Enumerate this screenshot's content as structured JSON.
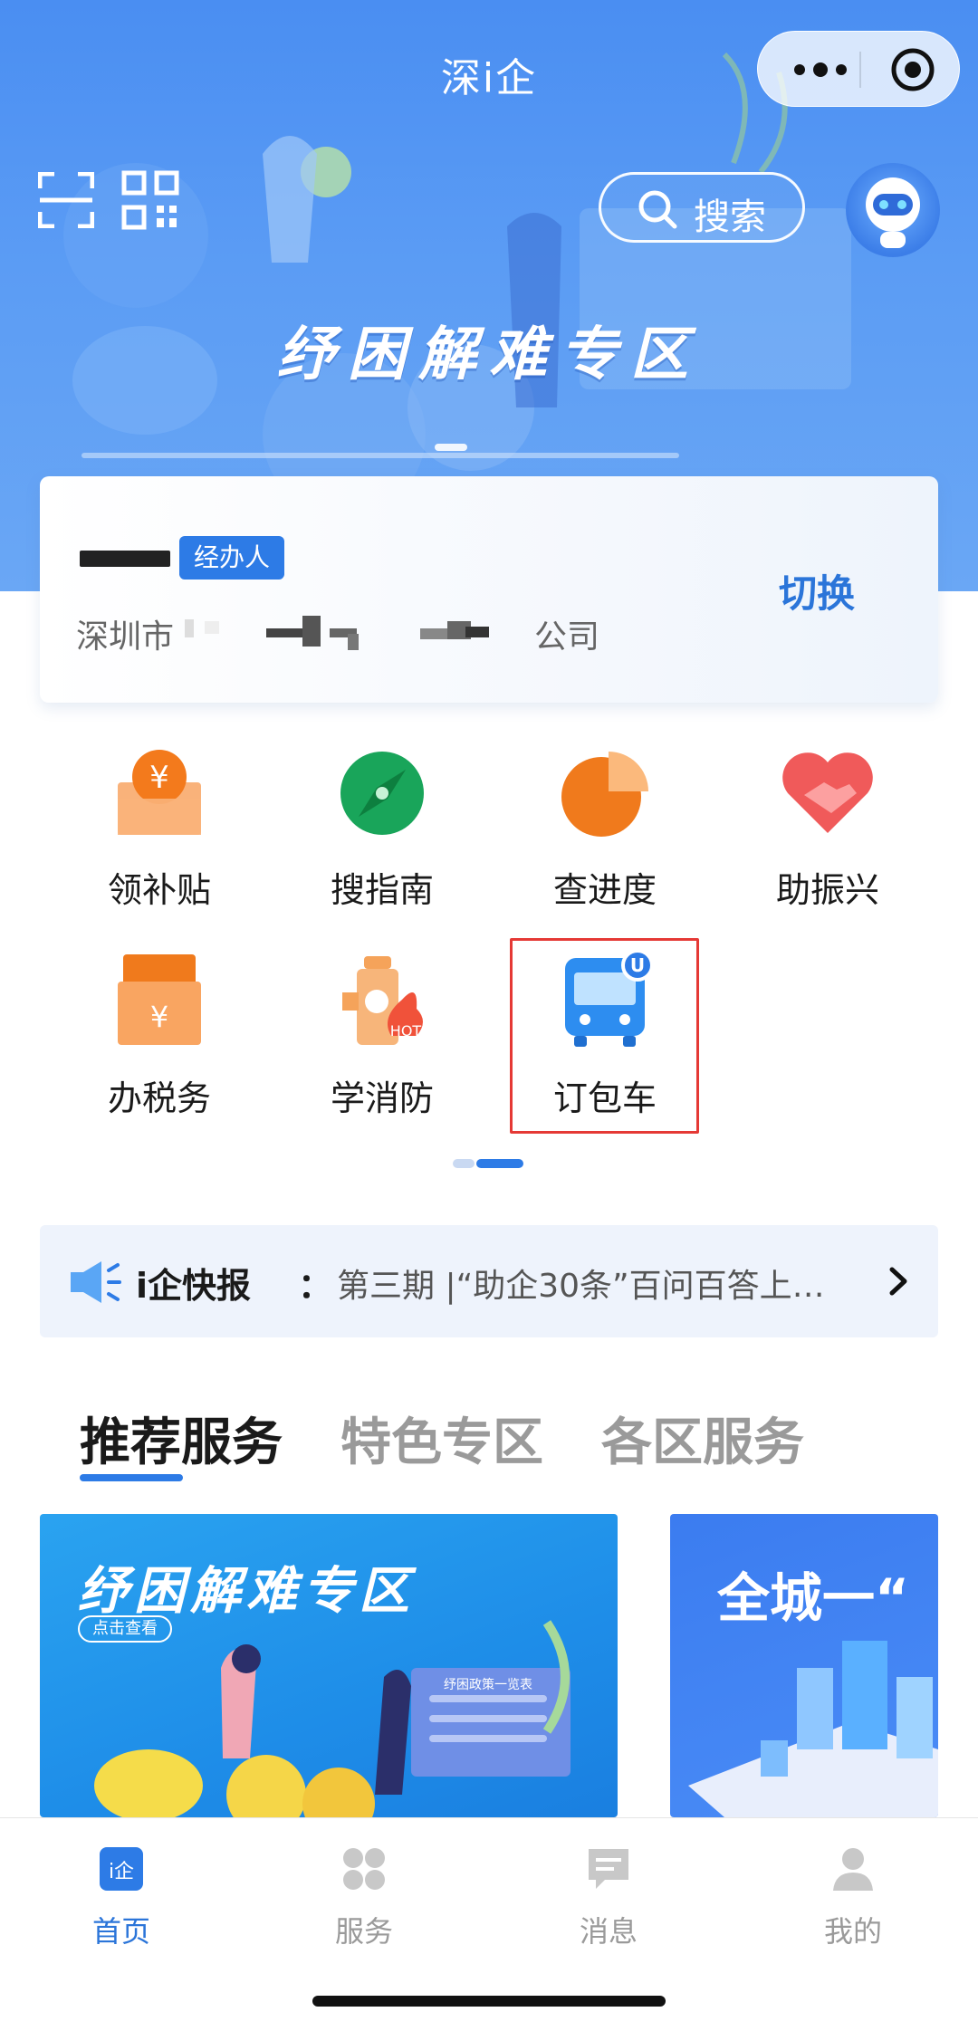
{
  "nav": {
    "title": "深i企"
  },
  "banner": {
    "search_label": "搜索",
    "slogan": "纾困解难专区"
  },
  "user": {
    "role": "经办人",
    "company_prefix": "深圳市",
    "company_suffix": "公司",
    "switch_label": "切换"
  },
  "quick_entries": [
    {
      "label": "领补贴",
      "icon": "subsidy-icon"
    },
    {
      "label": "搜指南",
      "icon": "compass-icon"
    },
    {
      "label": "查进度",
      "icon": "progress-pie-icon"
    },
    {
      "label": "助振兴",
      "icon": "handshake-heart-icon"
    },
    {
      "label": "办税务",
      "icon": "tax-envelope-icon"
    },
    {
      "label": "学消防",
      "icon": "fire-hydrant-icon"
    },
    {
      "label": "订包车",
      "icon": "bus-icon"
    }
  ],
  "ticker": {
    "label": "i企快报",
    "colon": "：",
    "text": "第三期 |“助企30条”百问百答上…"
  },
  "tabs": [
    {
      "label": "推荐服务",
      "active": true
    },
    {
      "label": "特色专区",
      "active": false
    },
    {
      "label": "各区服务",
      "active": false
    }
  ],
  "cards": [
    {
      "title": "纾困解难专区",
      "pill": "点击查看",
      "art_text": "纾困政策一览表"
    },
    {
      "title": "全城一“"
    }
  ],
  "tabbar": [
    {
      "label": "首页",
      "icon": "home-icon",
      "active": true
    },
    {
      "label": "服务",
      "icon": "services-icon",
      "active": false
    },
    {
      "label": "消息",
      "icon": "message-icon",
      "active": false
    },
    {
      "label": "我的",
      "icon": "profile-icon",
      "active": false
    }
  ],
  "colors": {
    "primary": "#2d7be6",
    "banner": "#4a8ef2",
    "highlight": "#e53935"
  }
}
